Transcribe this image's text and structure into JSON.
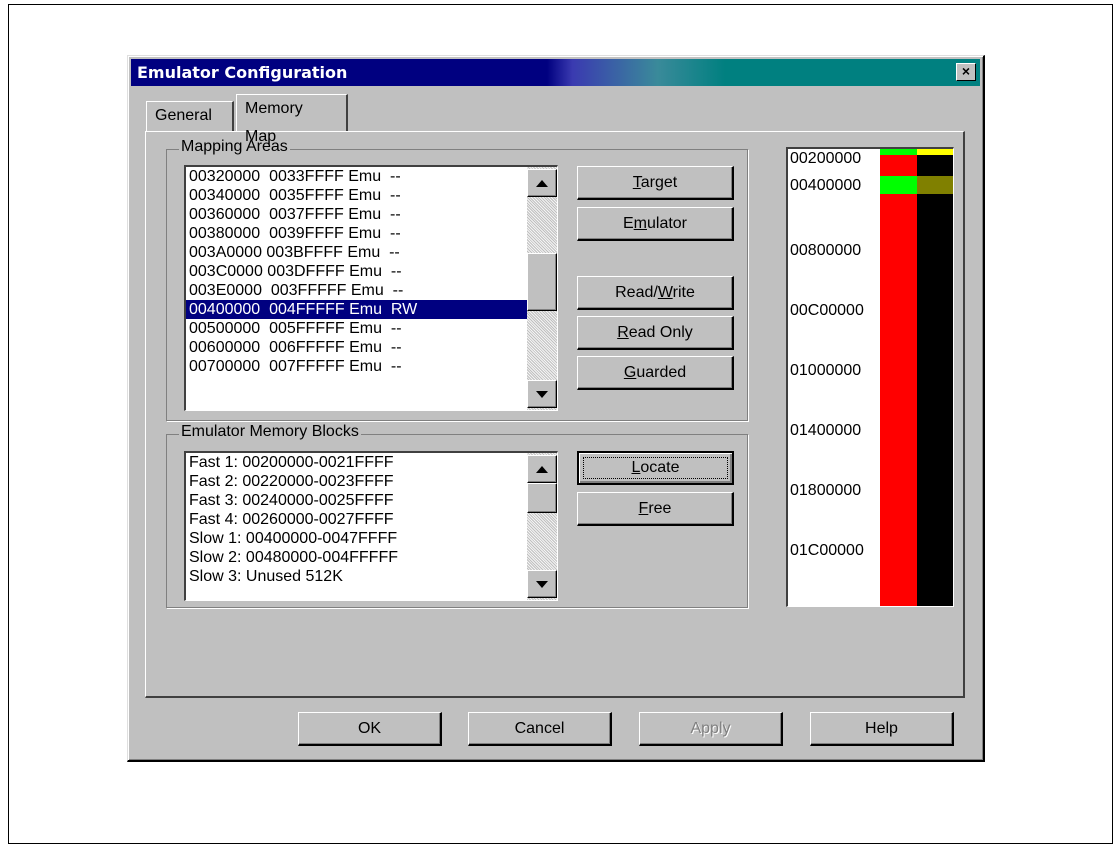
{
  "window": {
    "title": "Emulator Configuration",
    "close_glyph": "×"
  },
  "tabs": [
    {
      "label": "General",
      "active": false
    },
    {
      "label": "Memory Map",
      "active": true
    }
  ],
  "mapping_areas": {
    "label": "Mapping Areas",
    "items": [
      "00320000  0033FFFF Emu  --",
      "00340000  0035FFFF Emu  --",
      "00360000  0037FFFF Emu  --",
      "00380000  0039FFFF Emu  --",
      "003A0000 003BFFFF Emu  --",
      "003C0000 003DFFFF Emu  --",
      "003E0000  003FFFFF Emu  --",
      "00400000  004FFFFF Emu  RW",
      "00500000  005FFFFF Emu  --",
      "00600000  006FFFFF Emu  --",
      "00700000  007FFFFF Emu  --"
    ],
    "selected_index": 7
  },
  "mapping_buttons": {
    "target": {
      "pre": "",
      "key": "T",
      "post": "arget"
    },
    "emulator": {
      "pre": "E",
      "key": "m",
      "post": "ulator"
    },
    "read_write": {
      "pre": "Read/",
      "key": "W",
      "post": "rite"
    },
    "read_only": {
      "pre": "",
      "key": "R",
      "post": "ead Only"
    },
    "guarded": {
      "pre": "",
      "key": "G",
      "post": "uarded"
    }
  },
  "memory_blocks": {
    "label": "Emulator Memory Blocks",
    "items": [
      "Fast 1: 00200000-0021FFFF",
      "Fast 2: 00220000-0023FFFF",
      "Fast 3: 00240000-0025FFFF",
      "Fast 4: 00260000-0027FFFF",
      "Slow 1: 00400000-0047FFFF",
      "Slow 2: 00480000-004FFFFF",
      "Slow 3: Unused 512K"
    ]
  },
  "block_buttons": {
    "locate": {
      "pre": "",
      "key": "L",
      "post": "ocate"
    },
    "free": {
      "pre": "",
      "key": "F",
      "post": "ree"
    }
  },
  "memory_map": {
    "addresses": [
      "00200000",
      "00400000",
      "00800000",
      "00C00000",
      "01000000",
      "01400000",
      "01800000",
      "01C00000"
    ],
    "colors": {
      "mapped_emu": "#ff0000",
      "rw": "#00ff00",
      "unmapped": "#000000",
      "yellow": "#ffff00",
      "olive": "#808000"
    }
  },
  "footer_buttons": {
    "ok": "OK",
    "cancel": "Cancel",
    "apply": "Apply",
    "help": "Help"
  }
}
